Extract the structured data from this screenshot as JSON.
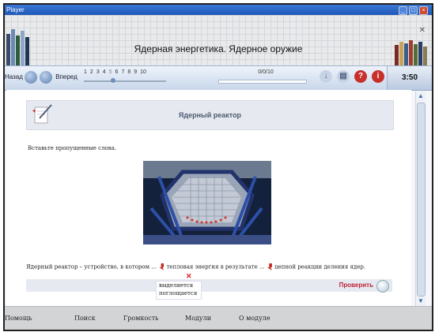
{
  "window": {
    "title": "Player"
  },
  "header": {
    "title": "Ядерная энергетика. Ядерное оружие"
  },
  "toolbar": {
    "back_label": "Назад",
    "forward_label": "Вперед",
    "pages": [
      "1",
      "2",
      "3",
      "4",
      "5",
      "6",
      "7",
      "8",
      "9",
      "10"
    ],
    "current_page": "5",
    "score": "0/0/10",
    "timer": "3:50"
  },
  "task": {
    "title": "Ядерный реактор",
    "instruction": "Вставьте пропущенные слова.",
    "sentence_part1": "Ядерный реактор – устройство, в котором ...",
    "sentence_part2": "тепловая энергия в результате ...",
    "sentence_part3": "цепной реакции деления ядер.",
    "dropdown_options": [
      "выделяется",
      "поглощается"
    ],
    "check_label": "Проверить"
  },
  "bottom_menu": [
    "Помощь",
    "Поиск",
    "Громкость",
    "Модули",
    "О модуле"
  ],
  "colors": {
    "accent_red": "#c0223a",
    "toolbar_blue": "#c8d7eb"
  }
}
